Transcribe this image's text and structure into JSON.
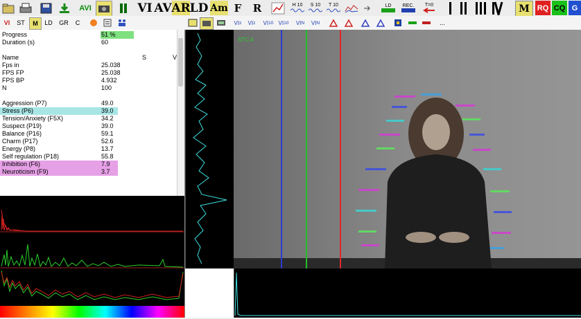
{
  "toolbar1": {
    "avi_label": "AVI",
    "vi_label": "VI",
    "av_label": "AV",
    "ar_label": "AR",
    "ld_label": "LD",
    "am_label": "Am",
    "f_label": "F",
    "r_label": "R",
    "h10_label": "H 10",
    "s10_label": "S 10",
    "t10_label": "T 10",
    "ld_small_label": "LD",
    "rec_label": "REC.",
    "t0_label": "T=0",
    "m_label": "M",
    "rq_label": "RQ",
    "cq_label": "CQ",
    "g_label": "G"
  },
  "toolbar2": {
    "tabs": [
      "VI",
      "ST",
      "M",
      "LD",
      "GR",
      "C"
    ],
    "ellipsis": "..."
  },
  "stats": {
    "rows": [
      {
        "label": "Progress",
        "value": "51 %"
      },
      {
        "label": "Duration (s)",
        "value": "60"
      },
      {
        "label": "",
        "value": ""
      },
      {
        "label": "Name",
        "value": "S"
      },
      {
        "label": "Fps in",
        "value": "25.038"
      },
      {
        "label": "FPS FP",
        "value": "25.038"
      },
      {
        "label": "FPS BP",
        "value": "4.932"
      },
      {
        "label": "N",
        "value": "100"
      },
      {
        "label": "",
        "value": ""
      },
      {
        "label": "Aggression (P7)",
        "value": "49.0"
      },
      {
        "label": "Stress (P6)",
        "value": "39.0"
      },
      {
        "label": "Tension/Anxiety (F5X)",
        "value": "34.2"
      },
      {
        "label": "Suspect (P19)",
        "value": "39.0"
      },
      {
        "label": "Balance (P16)",
        "value": "59.1"
      },
      {
        "label": "Charm (P17)",
        "value": "52.6"
      },
      {
        "label": "Energy (P8)",
        "value": "13.7"
      },
      {
        "label": "Self regulation (P18)",
        "value": "55.8"
      },
      {
        "label": "Inhibition (F6)",
        "value": "7.9"
      },
      {
        "label": "Neuroticism (F9)",
        "value": "3.7"
      }
    ],
    "name_col2": "V",
    "progress_fraction": 0.51
  },
  "video": {
    "overlay_label": "STC:4"
  },
  "colors": {
    "progress_green": "#7ee07e",
    "stress_highlight": "#a8e6e6",
    "inhibition_highlight": "#e6a0e6",
    "line_blue": "#2a3cd0",
    "line_green": "#22c022",
    "line_red": "#e02828",
    "signal_cyan": "#3fe0e0"
  }
}
